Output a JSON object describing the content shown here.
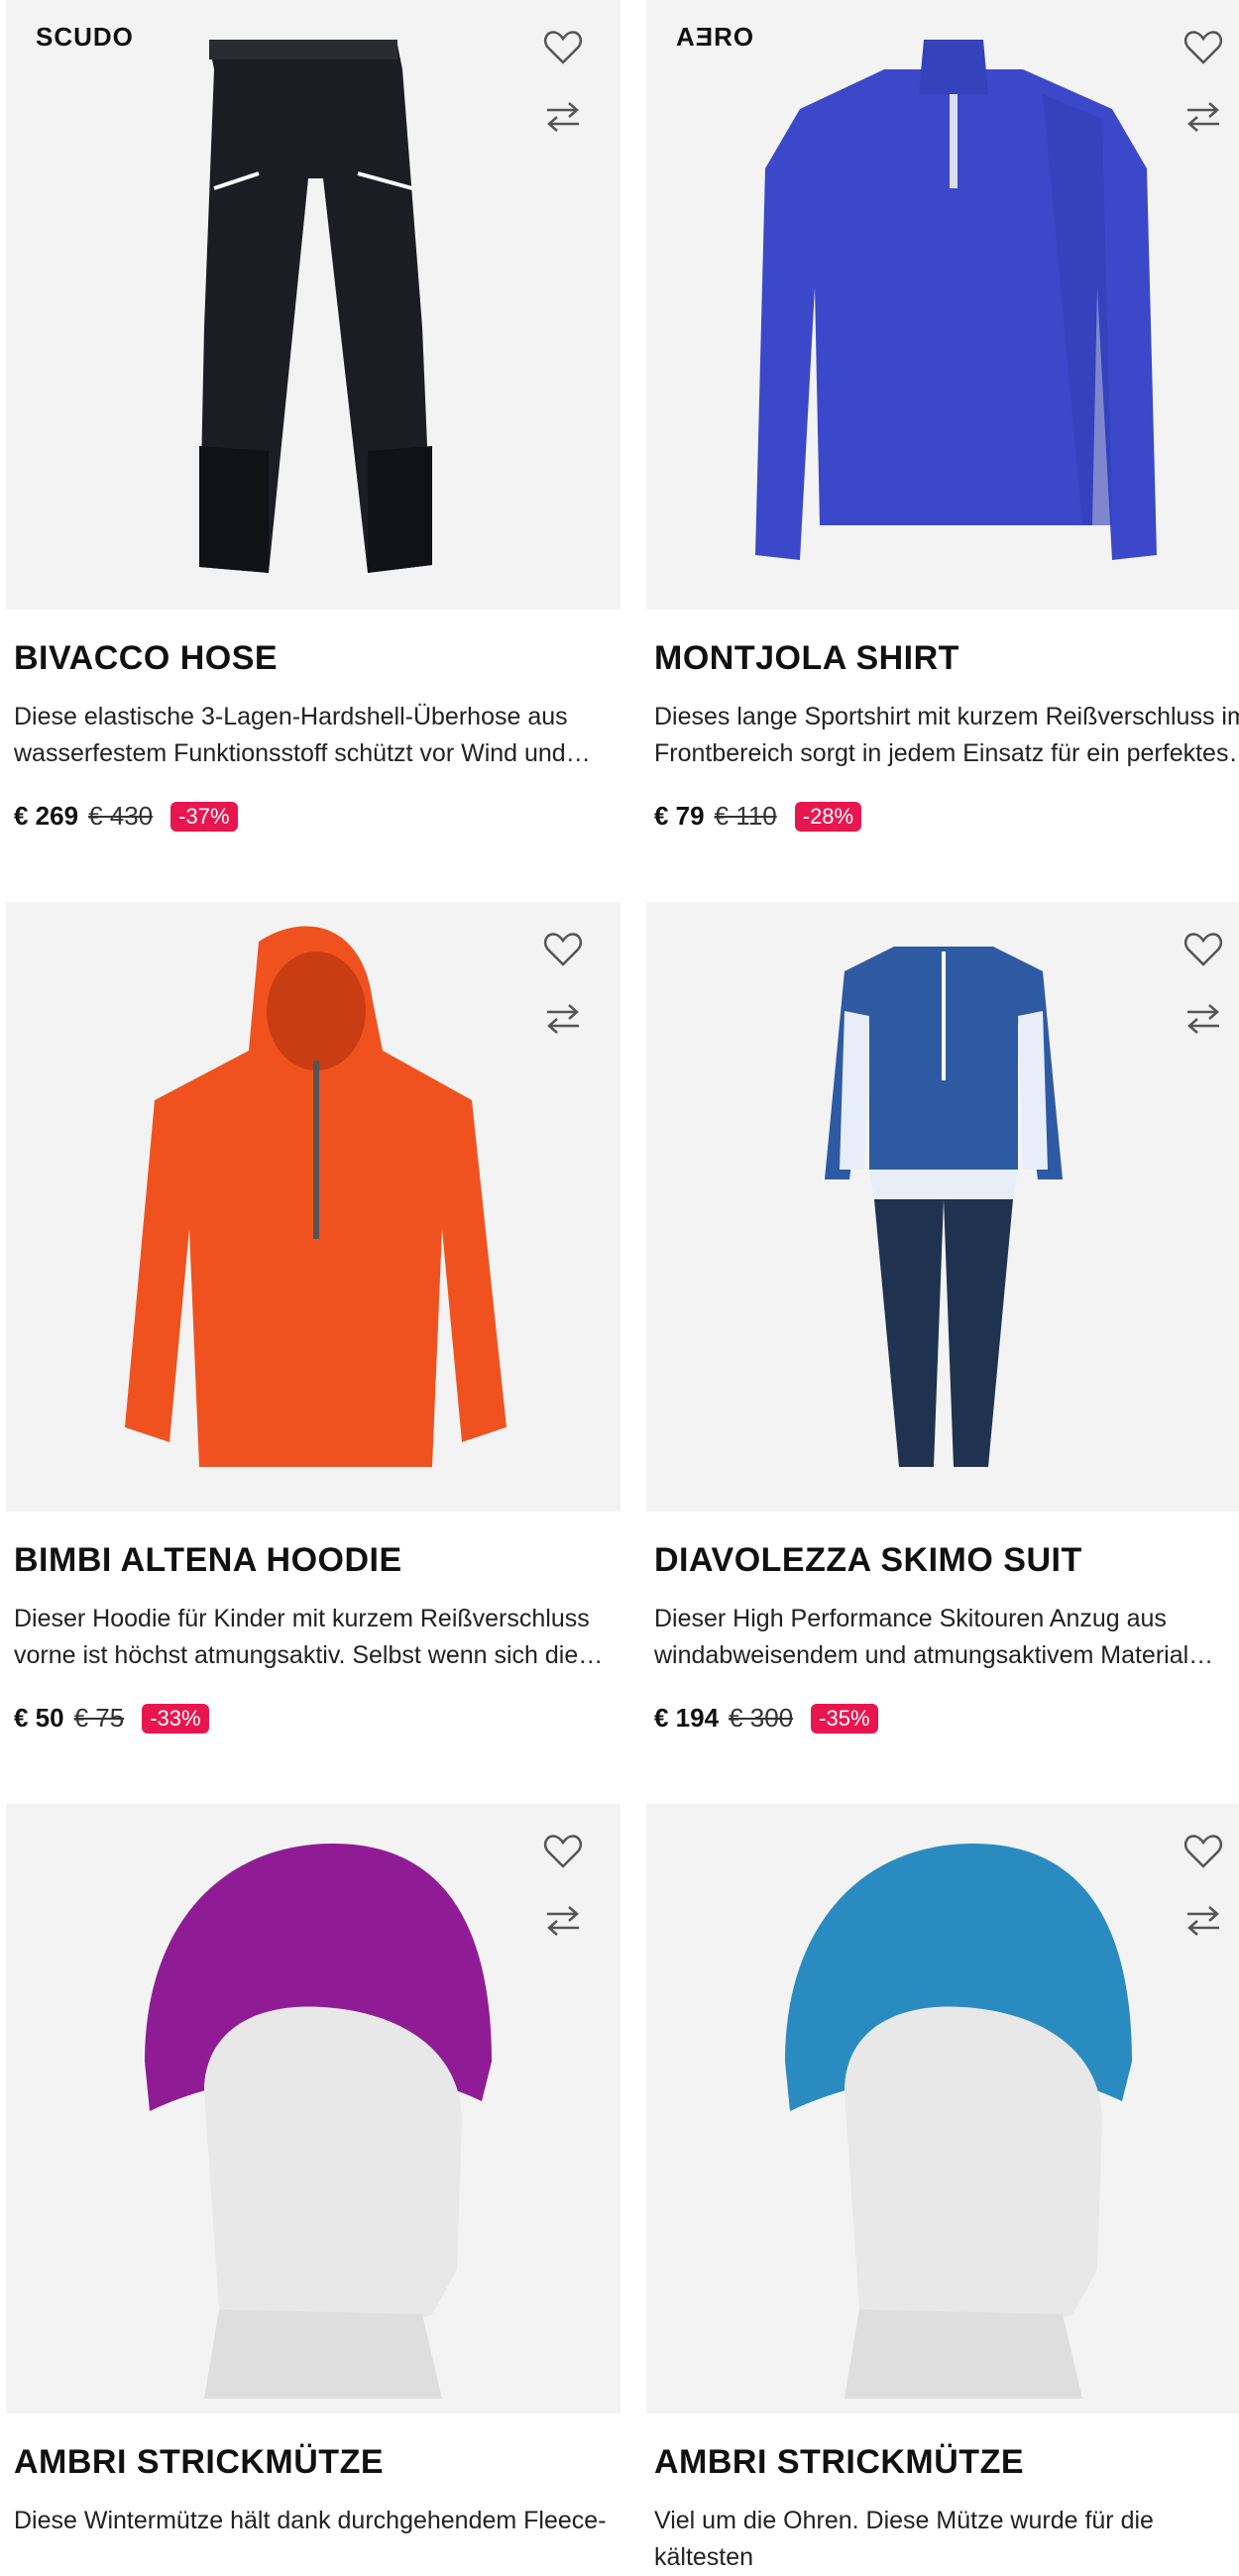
{
  "products": [
    {
      "brand": "SCUDO",
      "title": "BIVACCO HOSE",
      "description": "Diese elastische 3-Lagen-Hardshell-Überhose aus wasserfestem Funktionsstoff schützt vor Wind und…",
      "price": "€ 269",
      "old_price": "€ 430",
      "discount": "-37%",
      "image_icon": "pants-image",
      "color": "#1c1d22"
    },
    {
      "brand": "AƎRO",
      "title": "MONTJOLA SHIRT",
      "description": "Dieses lange Sportshirt mit kurzem Reißverschluss im Frontbereich sorgt in jedem Einsatz für ein perfektes…",
      "price": "€ 79",
      "old_price": "€ 110",
      "discount": "-28%",
      "image_icon": "shirt-image",
      "color": "#3b48c9"
    },
    {
      "brand": "",
      "title": "BIMBI ALTENA HOODIE",
      "description": "Dieser Hoodie für Kinder mit kurzem Reißverschluss vorne ist höchst atmungsaktiv. Selbst wenn sich die…",
      "price": "€ 50",
      "old_price": "€ 75",
      "discount": "-33%",
      "image_icon": "hoodie-image",
      "color": "#f0521f"
    },
    {
      "brand": "",
      "title": "DIAVOLEZZA SKIMO SUIT",
      "description": "Dieser High Performance Skitouren Anzug aus windabweisendem und atmungsaktivem Material…",
      "price": "€ 194",
      "old_price": "€ 300",
      "discount": "-35%",
      "image_icon": "suit-image",
      "color": "#2e5aa3"
    },
    {
      "brand": "",
      "title": "AMBRI STRICKMÜTZE",
      "description": "Diese Wintermütze hält dank durchgehendem Fleece-",
      "price": "",
      "old_price": "",
      "discount": "",
      "image_icon": "beanie-image",
      "color": "#8f1c95"
    },
    {
      "brand": "",
      "title": "AMBRI STRICKMÜTZE",
      "description": "Viel um die Ohren. Diese Mütze wurde für die kältesten",
      "price": "",
      "old_price": "",
      "discount": "",
      "image_icon": "beanie-image",
      "color": "#2a8bc0"
    }
  ],
  "icons": {
    "wishlist": "heart-icon",
    "compare": "compare-arrows-icon"
  },
  "colors": {
    "badge": "#e8164f",
    "image_bg": "#f3f3f3"
  }
}
